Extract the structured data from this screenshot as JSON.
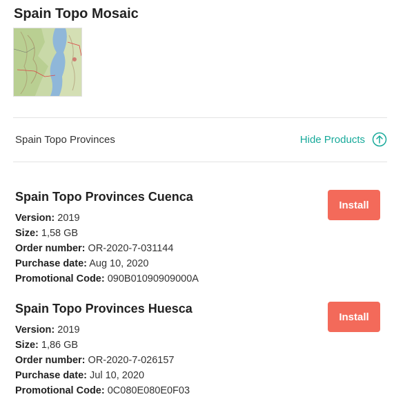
{
  "mosaic": {
    "title": "Spain Topo Mosaic"
  },
  "provinces_section": {
    "label": "Spain Topo Provinces",
    "toggle_label": "Hide Products"
  },
  "field_labels": {
    "version": "Version:",
    "size": "Size:",
    "order_number": "Order number:",
    "purchase_date": "Purchase date:",
    "promo_code": "Promotional Code:"
  },
  "products": [
    {
      "name": "Spain Topo Provinces Cuenca",
      "version": "2019",
      "size": "1,58 GB",
      "order_number": "OR-2020-7-031144",
      "purchase_date": "Aug 10, 2020",
      "promo_code": "090B01090909000A",
      "install_label": "Install"
    },
    {
      "name": "Spain Topo Provinces Huesca",
      "version": "2019",
      "size": "1,86 GB",
      "order_number": "OR-2020-7-026157",
      "purchase_date": "Jul 10, 2020",
      "promo_code": "0C080E080E0F03",
      "install_label": "Install"
    }
  ],
  "colors": {
    "accent": "#17a99a",
    "install_button": "#f36a5a"
  },
  "icons": {
    "toggle": "arrow-up-circle-icon"
  }
}
